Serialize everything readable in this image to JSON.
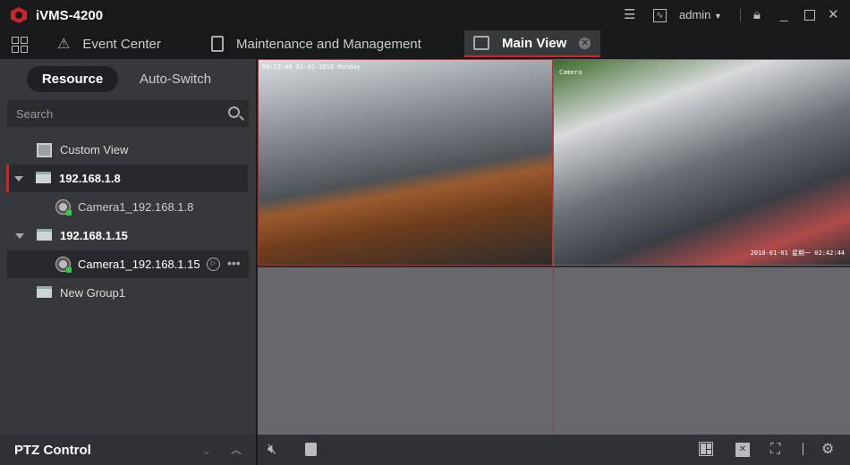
{
  "app": {
    "title": "iVMS-4200",
    "user": "admin"
  },
  "tabs": [
    {
      "label": "Event Center"
    },
    {
      "label": "Maintenance and Management"
    },
    {
      "label": "Main View",
      "active": true
    }
  ],
  "sidebar": {
    "segments": [
      "Resource",
      "Auto-Switch"
    ],
    "search_placeholder": "Search",
    "tree": [
      {
        "label": "Custom View"
      },
      {
        "label": "192.168.1.8",
        "expanded": true
      },
      {
        "label": "Camera1_192.168.1.8"
      },
      {
        "label": "192.168.1.15",
        "expanded": true
      },
      {
        "label": "Camera1_192.168.1.15"
      },
      {
        "label": "New Group1"
      }
    ],
    "ptz_label": "PTZ Control"
  },
  "video": {
    "tile1_osd": "00:12:46 01-01-2018 Monday",
    "tile2_osd_name": "Camera",
    "tile2_osd_time": "2018-01-01 星期一 02:42:44"
  },
  "colors": {
    "accent": "#c8262c",
    "online": "#2ecc40"
  }
}
